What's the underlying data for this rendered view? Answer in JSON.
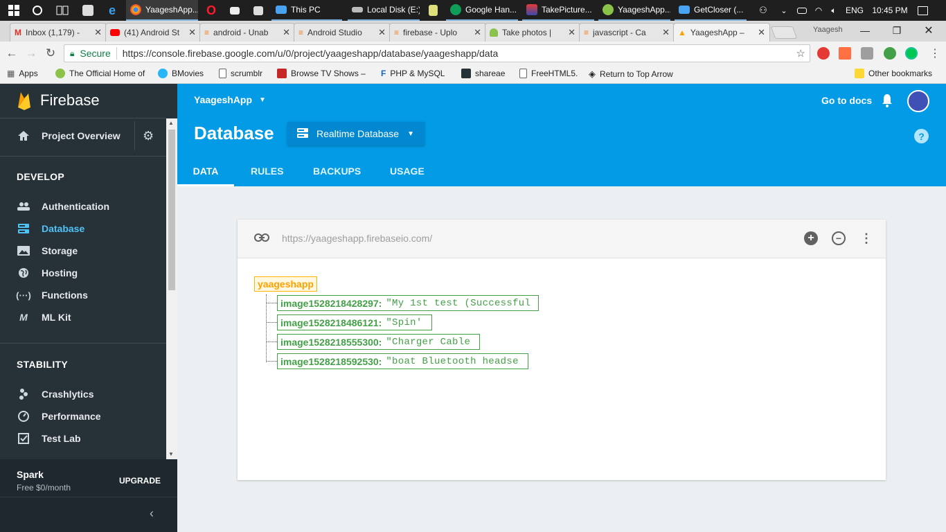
{
  "taskbar": {
    "apps": [
      {
        "label": "YaageshApp..."
      },
      {
        "label": "This PC"
      },
      {
        "label": "Local Disk (E:)"
      },
      {
        "label": "Google Han..."
      },
      {
        "label": "TakePicture..."
      },
      {
        "label": "YaageshApp..."
      },
      {
        "label": "GetCloser (..."
      }
    ],
    "lang": "ENG",
    "time": "10:45 PM"
  },
  "browser": {
    "tabs": [
      {
        "label": "Inbox (1,179) -"
      },
      {
        "label": "(41) Android St"
      },
      {
        "label": "android - Unab"
      },
      {
        "label": "Android Studio"
      },
      {
        "label": "firebase - Uplo"
      },
      {
        "label": "Take photos |"
      },
      {
        "label": "javascript - Ca"
      },
      {
        "label": "YaageshApp –"
      }
    ],
    "profile_name": "Yaagesh",
    "secure_label": "Secure",
    "url": "https://console.firebase.google.com/u/0/project/yaageshapp/database/yaageshapp/data",
    "bookmarks": [
      {
        "label": "Apps"
      },
      {
        "label": "The Official Home of"
      },
      {
        "label": "BMovies"
      },
      {
        "label": "scrumblr"
      },
      {
        "label": "Browse TV Shows – "
      },
      {
        "label": "PHP & MySQL"
      },
      {
        "label": "shareae"
      },
      {
        "label": "FreeHTML5."
      },
      {
        "label": "Return to Top Arrow"
      },
      {
        "label": "Other bookmarks"
      }
    ]
  },
  "sidebar": {
    "brand": "Firebase",
    "overview": "Project Overview",
    "develop_title": "DEVELOP",
    "develop_items": [
      {
        "label": "Authentication"
      },
      {
        "label": "Database"
      },
      {
        "label": "Storage"
      },
      {
        "label": "Hosting"
      },
      {
        "label": "Functions"
      },
      {
        "label": "ML Kit"
      }
    ],
    "stability_title": "STABILITY",
    "stability_items": [
      {
        "label": "Crashlytics"
      },
      {
        "label": "Performance"
      },
      {
        "label": "Test Lab"
      }
    ],
    "plan_name": "Spark",
    "plan_price": "Free $0/month",
    "upgrade": "UPGRADE"
  },
  "header": {
    "project": "YaageshApp",
    "title": "Database",
    "db_type": "Realtime Database",
    "tabs": [
      {
        "label": "DATA"
      },
      {
        "label": "RULES"
      },
      {
        "label": "BACKUPS"
      },
      {
        "label": "USAGE"
      }
    ],
    "docs": "Go to docs",
    "help": "?"
  },
  "data_card": {
    "db_url": "https://yaageshapp.firebaseio.com/",
    "root": "yaageshapp",
    "children": [
      {
        "key": "image1528218428297:",
        "value": "\"My 1st test (Successful"
      },
      {
        "key": "image1528218486121:",
        "value": "\"Spin'"
      },
      {
        "key": "image1528218555300:",
        "value": "\"Charger Cable"
      },
      {
        "key": "image1528218592530:",
        "value": "\"boat Bluetooth headse"
      }
    ]
  },
  "colors": {
    "header_bg": "#039be5",
    "sidebar_bg": "#263238",
    "active_nav": "#4fc3f7",
    "root_node": "#ffa000",
    "child_node": "#43a047"
  }
}
